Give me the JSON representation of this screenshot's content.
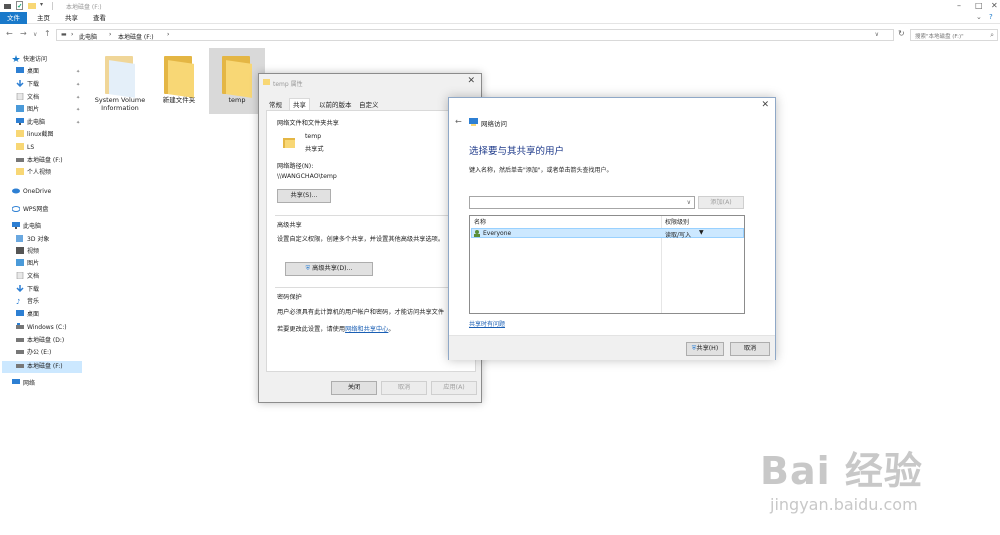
{
  "window": {
    "title": "本地磁盘 (F:)"
  },
  "ribbon": {
    "tabs": [
      "文件",
      "主页",
      "共享",
      "查看"
    ]
  },
  "address": {
    "path": [
      "此电脑",
      "本地磁盘 (F:)"
    ],
    "search_placeholder": "搜索\"本地磁盘 (F:)\""
  },
  "nav": {
    "quick_access": "快速访问",
    "items": [
      {
        "label": "桌面",
        "icon": "desktop-icon",
        "pinned": true
      },
      {
        "label": "下载",
        "icon": "download-icon",
        "pinned": true
      },
      {
        "label": "文档",
        "icon": "document-icon",
        "pinned": true
      },
      {
        "label": "图片",
        "icon": "picture-icon",
        "pinned": true
      },
      {
        "label": "此电脑",
        "icon": "computer-icon",
        "pinned": true
      },
      {
        "label": "linux截图",
        "icon": "folder-icon",
        "pinned": false
      },
      {
        "label": "LS",
        "icon": "folder-icon",
        "pinned": false
      },
      {
        "label": "本地磁盘 (F:)",
        "icon": "drive-icon",
        "pinned": false
      },
      {
        "label": "个人视频",
        "icon": "folder-icon",
        "pinned": false
      }
    ],
    "onedrive": "OneDrive",
    "wps": "WPS网盘",
    "this_pc": "此电脑",
    "pc_items": [
      {
        "label": "3D 对象",
        "icon": "cube-icon"
      },
      {
        "label": "视频",
        "icon": "video-icon"
      },
      {
        "label": "图片",
        "icon": "picture-icon"
      },
      {
        "label": "文档",
        "icon": "document-icon"
      },
      {
        "label": "下载",
        "icon": "download-icon"
      },
      {
        "label": "音乐",
        "icon": "music-icon"
      },
      {
        "label": "桌面",
        "icon": "desktop-icon"
      },
      {
        "label": "Windows (C:)",
        "icon": "drive-icon"
      },
      {
        "label": "本地磁盘 (D:)",
        "icon": "drive-icon"
      },
      {
        "label": "办公 (E:)",
        "icon": "drive-icon"
      },
      {
        "label": "本地磁盘 (F:)",
        "icon": "drive-icon"
      }
    ],
    "network": "网络"
  },
  "files": [
    {
      "name": "System Volume Information"
    },
    {
      "name": "新建文件夹"
    },
    {
      "name": "temp"
    }
  ],
  "props": {
    "title": "temp 属性",
    "tabs": [
      "常规",
      "共享",
      "以前的版本",
      "自定义"
    ],
    "section1": "网络文件和文件夹共享",
    "folder_name": "temp",
    "share_state": "共享式",
    "path_label": "网络路径(N):",
    "path_value": "\\\\WANGCHAO\\temp",
    "share_button": "共享(S)...",
    "section2": "高级共享",
    "adv_desc": "设置自定义权限，创建多个共享，并设置其他高级共享选项。",
    "adv_button": "高级共享(D)...",
    "section3": "密码保护",
    "pwd_desc": "用户必须具有此计算机的用户帐户和密码，才能访问共享文件",
    "change_prefix": "若要更改此设置，请使用",
    "change_link": "网络和共享中心",
    "change_suffix": "。",
    "ok": "关闭",
    "cancel": "取消",
    "apply": "应用(A)"
  },
  "net": {
    "title": "网络访问",
    "heading": "选择要与其共享的用户",
    "desc": "键入名称，然后单击\"添加\"，或者单击箭头查找用户。",
    "add_button": "添加(A)",
    "col_name": "名称",
    "col_perm": "权限级别",
    "rows": [
      {
        "name": "Everyone",
        "perm": "读取/写入"
      }
    ],
    "help_link": "共享时有问题",
    "share_button": "共享(H)",
    "cancel_button": "取消"
  },
  "watermark": {
    "logo": "Bai 经验",
    "url": "jingyan.baidu.com"
  },
  "colors": {
    "accent": "#1979ca",
    "heading": "#1e3a8a",
    "folder": "#f8d775",
    "selection": "#cce8ff"
  }
}
